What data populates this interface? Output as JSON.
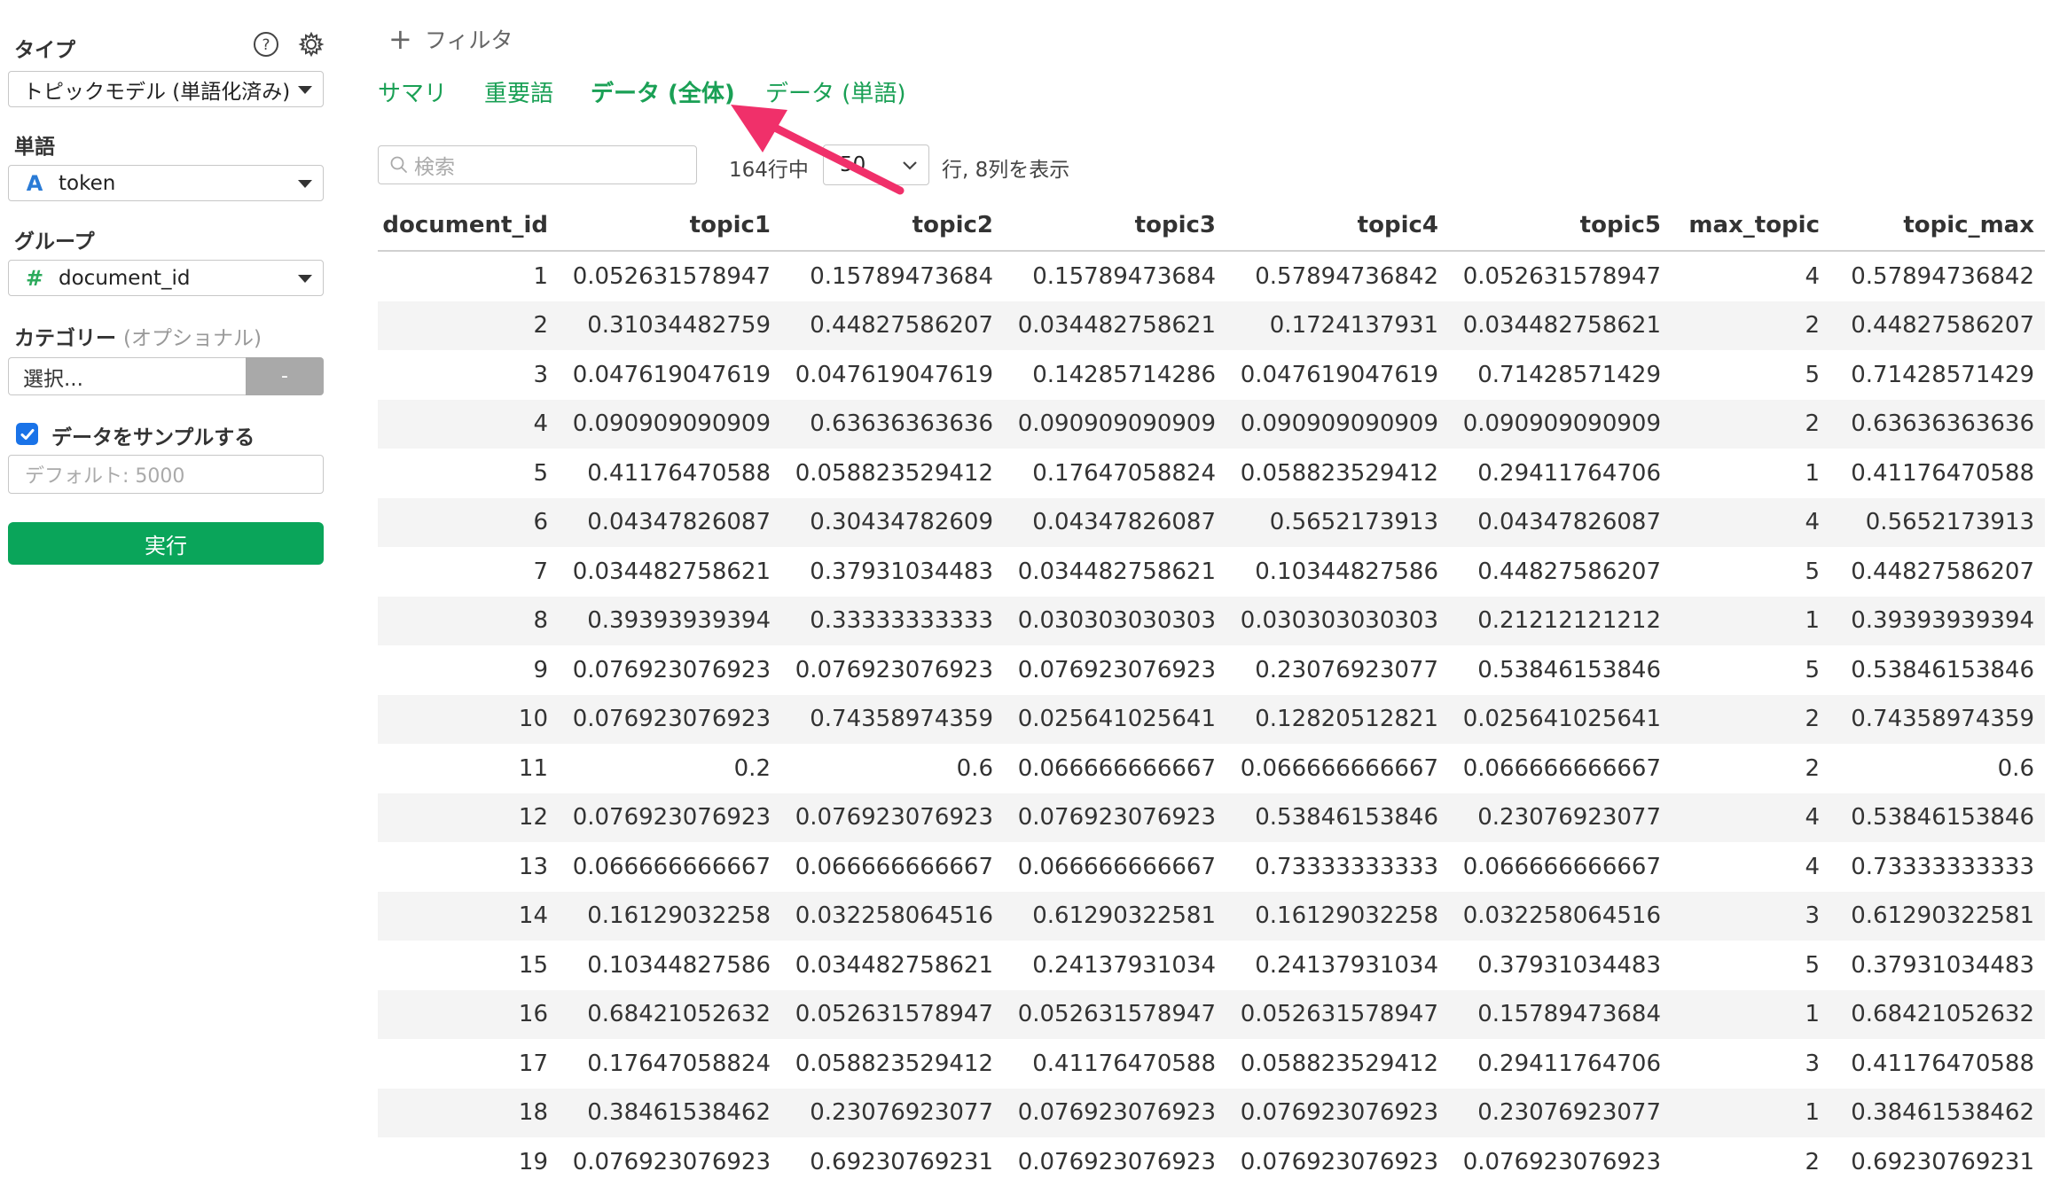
{
  "sidebar": {
    "type_label": "タイプ",
    "type_value": "トピックモデル (単語化済み)",
    "word_label": "単語",
    "word_type_icon": "A",
    "word_value": "token",
    "group_label": "グループ",
    "group_type_icon": "#",
    "group_value": "document_id",
    "category_label": "カテゴリー",
    "category_optional": "(オプショナル)",
    "category_placeholder": "選択...",
    "category_button": "-",
    "sample_label": "データをサンプルする",
    "sample_checked": true,
    "sample_placeholder": "デフォルト: 5000",
    "run_label": "実行"
  },
  "main": {
    "filter_label": "フィルタ",
    "tabs": [
      {
        "label": "サマリ",
        "active": false
      },
      {
        "label": "重要語",
        "active": false
      },
      {
        "label": "データ (全体)",
        "active": true
      },
      {
        "label": "データ (単語)",
        "active": false
      }
    ],
    "search_placeholder": "検索",
    "rows_prefix": "164行中",
    "page_size": "50",
    "rows_suffix": "行, 8列を表示"
  },
  "table": {
    "columns": [
      "document_id",
      "topic1",
      "topic2",
      "topic3",
      "topic4",
      "topic5",
      "max_topic",
      "topic_max"
    ],
    "rows": [
      [
        "1",
        "0.052631578947",
        "0.15789473684",
        "0.15789473684",
        "0.57894736842",
        "0.052631578947",
        "4",
        "0.57894736842"
      ],
      [
        "2",
        "0.31034482759",
        "0.44827586207",
        "0.034482758621",
        "0.1724137931",
        "0.034482758621",
        "2",
        "0.44827586207"
      ],
      [
        "3",
        "0.047619047619",
        "0.047619047619",
        "0.14285714286",
        "0.047619047619",
        "0.71428571429",
        "5",
        "0.71428571429"
      ],
      [
        "4",
        "0.090909090909",
        "0.63636363636",
        "0.090909090909",
        "0.090909090909",
        "0.090909090909",
        "2",
        "0.63636363636"
      ],
      [
        "5",
        "0.41176470588",
        "0.058823529412",
        "0.17647058824",
        "0.058823529412",
        "0.29411764706",
        "1",
        "0.41176470588"
      ],
      [
        "6",
        "0.04347826087",
        "0.30434782609",
        "0.04347826087",
        "0.5652173913",
        "0.04347826087",
        "4",
        "0.5652173913"
      ],
      [
        "7",
        "0.034482758621",
        "0.37931034483",
        "0.034482758621",
        "0.10344827586",
        "0.44827586207",
        "5",
        "0.44827586207"
      ],
      [
        "8",
        "0.39393939394",
        "0.33333333333",
        "0.030303030303",
        "0.030303030303",
        "0.21212121212",
        "1",
        "0.39393939394"
      ],
      [
        "9",
        "0.076923076923",
        "0.076923076923",
        "0.076923076923",
        "0.23076923077",
        "0.53846153846",
        "5",
        "0.53846153846"
      ],
      [
        "10",
        "0.076923076923",
        "0.74358974359",
        "0.025641025641",
        "0.12820512821",
        "0.025641025641",
        "2",
        "0.74358974359"
      ],
      [
        "11",
        "0.2",
        "0.6",
        "0.066666666667",
        "0.066666666667",
        "0.066666666667",
        "2",
        "0.6"
      ],
      [
        "12",
        "0.076923076923",
        "0.076923076923",
        "0.076923076923",
        "0.53846153846",
        "0.23076923077",
        "4",
        "0.53846153846"
      ],
      [
        "13",
        "0.066666666667",
        "0.066666666667",
        "0.066666666667",
        "0.73333333333",
        "0.066666666667",
        "4",
        "0.73333333333"
      ],
      [
        "14",
        "0.16129032258",
        "0.032258064516",
        "0.61290322581",
        "0.16129032258",
        "0.032258064516",
        "3",
        "0.61290322581"
      ],
      [
        "15",
        "0.10344827586",
        "0.034482758621",
        "0.24137931034",
        "0.24137931034",
        "0.37931034483",
        "5",
        "0.37931034483"
      ],
      [
        "16",
        "0.68421052632",
        "0.052631578947",
        "0.052631578947",
        "0.052631578947",
        "0.15789473684",
        "1",
        "0.68421052632"
      ],
      [
        "17",
        "0.17647058824",
        "0.058823529412",
        "0.41176470588",
        "0.058823529412",
        "0.29411764706",
        "3",
        "0.41176470588"
      ],
      [
        "18",
        "0.38461538462",
        "0.23076923077",
        "0.076923076923",
        "0.076923076923",
        "0.23076923077",
        "1",
        "0.38461538462"
      ],
      [
        "19",
        "0.076923076923",
        "0.69230769231",
        "0.076923076923",
        "0.076923076923",
        "0.076923076923",
        "2",
        "0.69230769231"
      ]
    ]
  },
  "colors": {
    "accent_green": "#1aa055",
    "run_button": "#0aa55a",
    "annotation_arrow": "#f0306a",
    "checkbox": "#1a73e8"
  }
}
